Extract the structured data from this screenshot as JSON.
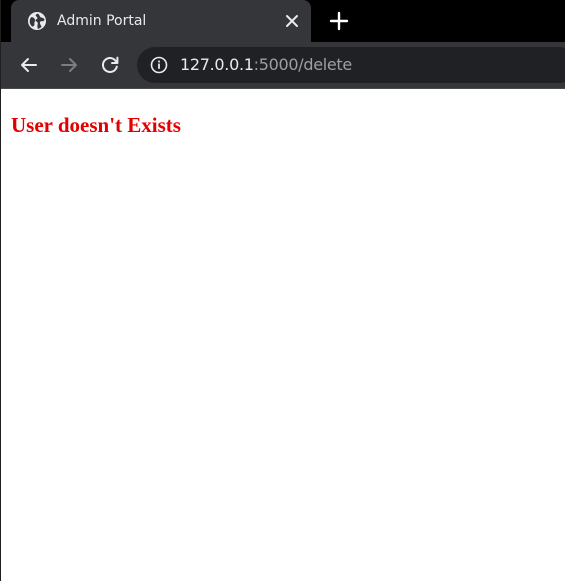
{
  "browser": {
    "tab": {
      "title": "Admin Portal",
      "favicon": "globe-icon"
    },
    "new_tab_icon": "plus-icon",
    "toolbar": {
      "back_icon": "back-arrow-icon",
      "forward_icon": "forward-arrow-icon",
      "reload_icon": "reload-icon",
      "info_icon": "info-icon"
    },
    "address_bar": {
      "host": "127.0.0.1",
      "rest": ":5000/delete"
    }
  },
  "page": {
    "message": "User doesn't Exists",
    "message_color": "#e50000"
  },
  "colors": {
    "tab_strip": "#000000",
    "toolbar": "#35363a",
    "omnibox": "#202124"
  }
}
